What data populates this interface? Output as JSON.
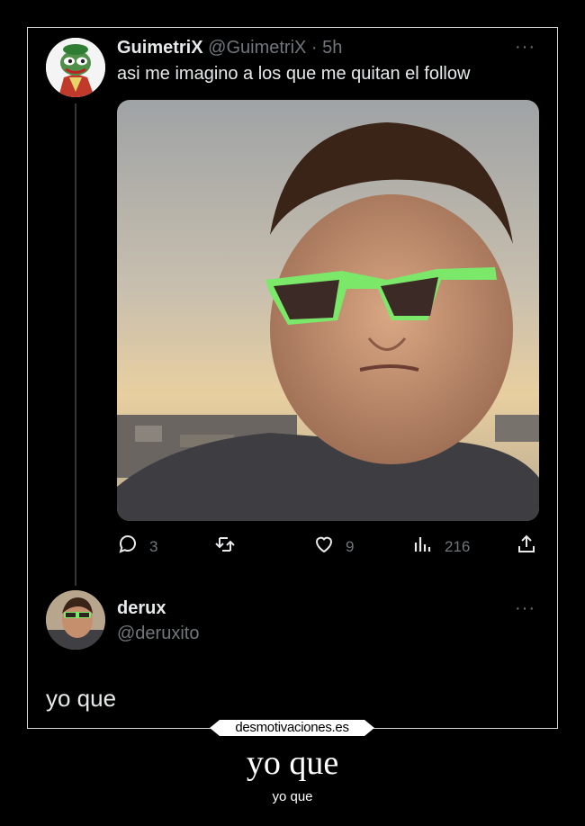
{
  "tweet": {
    "display_name": "GuimetriX",
    "handle_time": "@GuimetriX · 5h",
    "more": "···",
    "text": "asi me imagino a los que me quitan el follow",
    "media_alt": "Selfie of a man with green sunglasses at sunset",
    "actions": {
      "replies": "3",
      "retweets": "",
      "likes": "9",
      "views": "216"
    }
  },
  "reply": {
    "display_name": "derux",
    "handle": "@deruxito",
    "more": "···",
    "text": "yo que"
  },
  "watermark": "desmotivaciones.es",
  "caption": {
    "title": "yo que",
    "subtitle": "yo que"
  },
  "icons": [
    "reply-icon",
    "retweet-icon",
    "like-icon",
    "views-icon",
    "share-icon"
  ]
}
